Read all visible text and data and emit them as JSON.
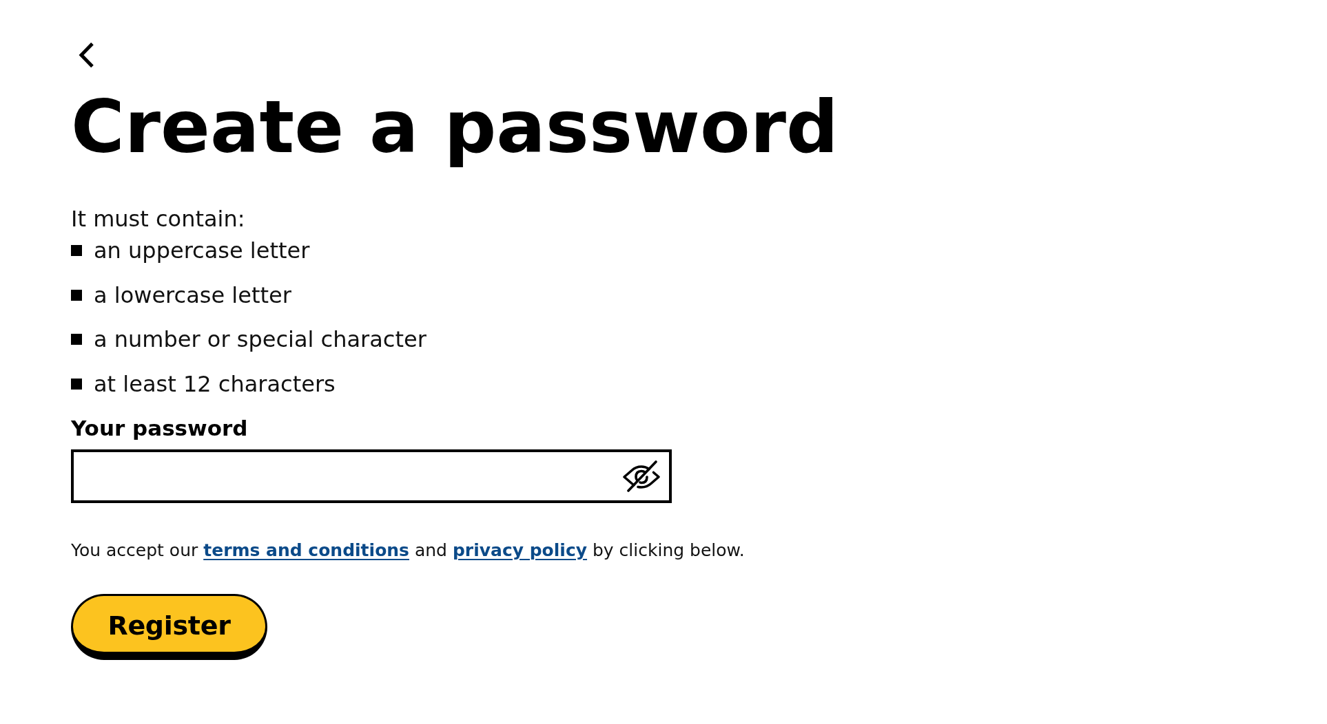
{
  "title": "Create a password",
  "requirements": {
    "intro": "It must contain:",
    "items": [
      "an uppercase letter",
      "a lowercase letter",
      "a number or special character",
      "at least 12 characters"
    ]
  },
  "password_field": {
    "label": "Your password"
  },
  "consent": [
    {
      "kind": "text",
      "text": "You accept our "
    },
    {
      "kind": "link",
      "text": "terms and conditions"
    },
    {
      "kind": "text",
      "text": " and "
    },
    {
      "kind": "link",
      "text": "privacy policy"
    },
    {
      "kind": "text",
      "text": " by clicking below."
    }
  ],
  "register_button": "Register"
}
